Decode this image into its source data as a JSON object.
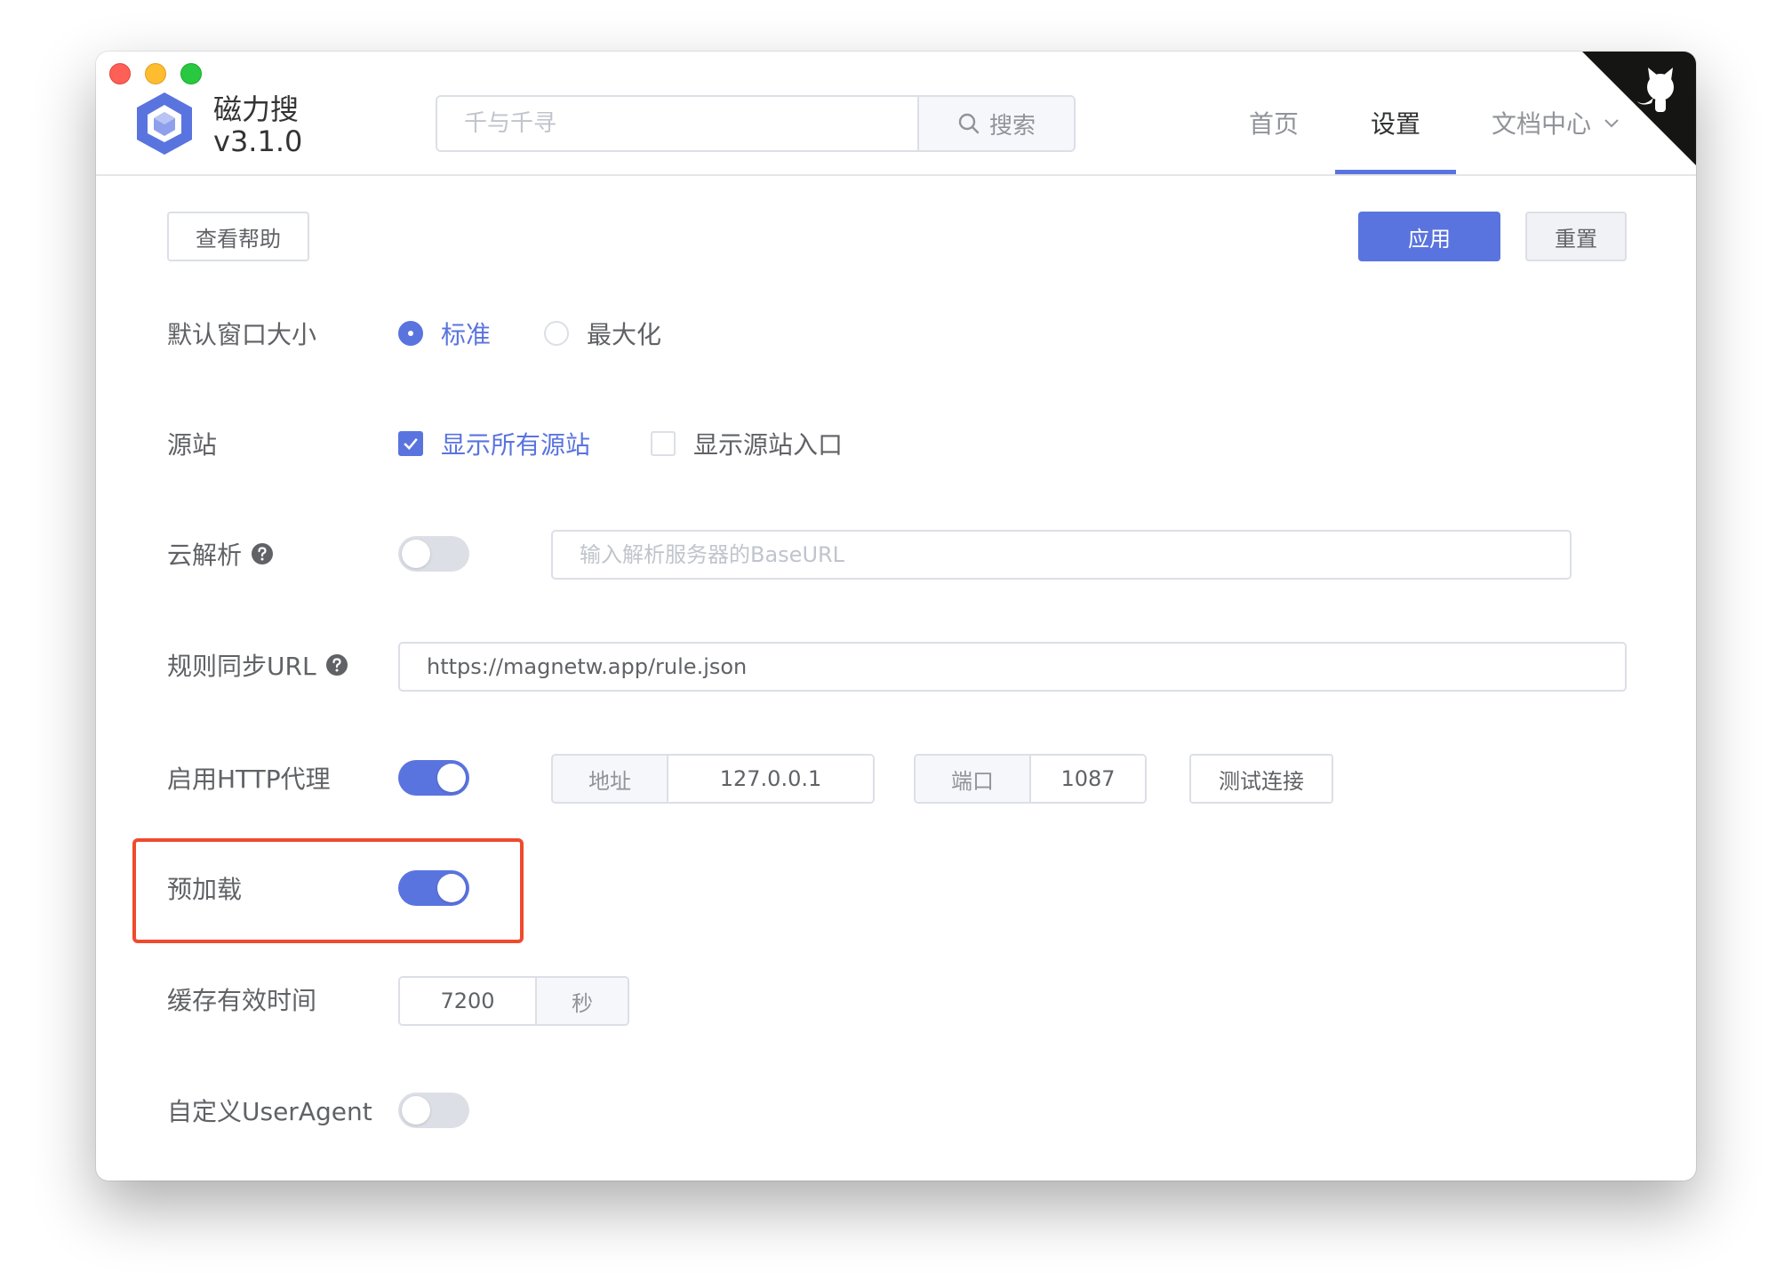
{
  "app": {
    "name": "磁力搜",
    "version": "v3.1.0"
  },
  "search": {
    "placeholder": "千与千寻",
    "button_label": "搜索"
  },
  "nav": {
    "home": "首页",
    "settings": "设置",
    "docs": "文档中心"
  },
  "toolbar": {
    "help_label": "查看帮助",
    "apply_label": "应用",
    "reset_label": "重置"
  },
  "settings": {
    "window_size": {
      "label": "默认窗口大小",
      "options": [
        "标准",
        "最大化"
      ],
      "selected": "标准"
    },
    "source": {
      "label": "源站",
      "show_all": "显示所有源站",
      "show_all_checked": true,
      "show_entry": "显示源站入口",
      "show_entry_checked": false
    },
    "cloud_parse": {
      "label": "云解析",
      "enabled": false,
      "placeholder": "输入解析服务器的BaseURL"
    },
    "rule_sync": {
      "label": "规则同步URL",
      "value": "https://magnetw.app/rule.json"
    },
    "http_proxy": {
      "label": "启用HTTP代理",
      "enabled": true,
      "address_label": "地址",
      "address": "127.0.0.1",
      "port_label": "端口",
      "port": "1087",
      "test_label": "测试连接"
    },
    "preload": {
      "label": "预加载",
      "enabled": true
    },
    "cache": {
      "label": "缓存有效时间",
      "value": "7200",
      "unit": "秒"
    },
    "user_agent": {
      "label": "自定义UserAgent",
      "enabled": false
    }
  },
  "colors": {
    "accent": "#5a74df",
    "highlight": "#f04a2e"
  }
}
